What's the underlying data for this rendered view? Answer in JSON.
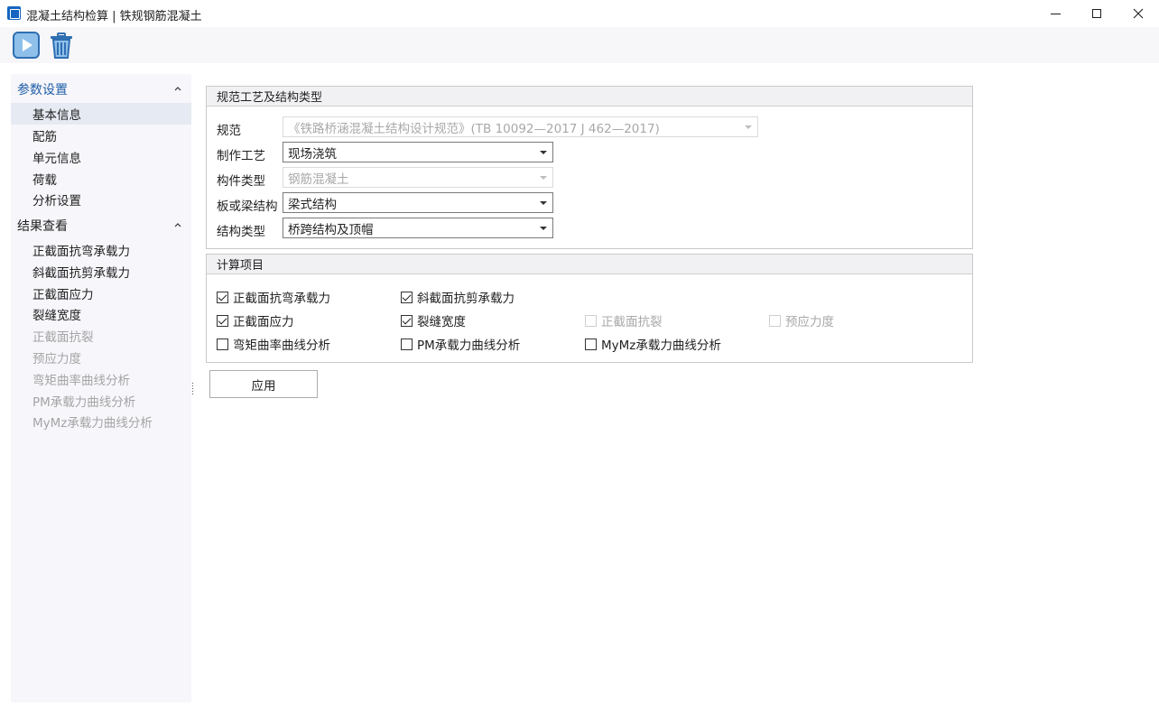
{
  "window": {
    "title": "混凝土结构检算 | 铁规钢筋混凝土"
  },
  "toolbar": {
    "run_icon": "play-icon",
    "delete_icon": "trash-icon"
  },
  "sidebar": {
    "groups": [
      {
        "title": "参数设置",
        "items": [
          {
            "label": "基本信息"
          },
          {
            "label": "配筋"
          },
          {
            "label": "单元信息"
          },
          {
            "label": "荷载"
          },
          {
            "label": "分析设置"
          }
        ]
      },
      {
        "title": "结果查看",
        "items": [
          {
            "label": "正截面抗弯承载力"
          },
          {
            "label": "斜截面抗剪承载力"
          },
          {
            "label": "正截面应力"
          },
          {
            "label": "裂缝宽度"
          },
          {
            "label": "正截面抗裂"
          },
          {
            "label": "预应力度"
          },
          {
            "label": "弯矩曲率曲线分析"
          },
          {
            "label": "PM承载力曲线分析"
          },
          {
            "label": "MyMz承载力曲线分析"
          }
        ]
      }
    ]
  },
  "spec_panel": {
    "title": "规范工艺及结构类型",
    "fields": [
      {
        "label": "规范",
        "value": "《铁路桥涵混凝土结构设计规范》(TB 10092—2017 J 462—2017)"
      },
      {
        "label": "制作工艺",
        "value": "现场浇筑"
      },
      {
        "label": "构件类型",
        "value": "钢筋混凝土"
      },
      {
        "label": "板或梁结构",
        "value": "梁式结构"
      },
      {
        "label": "结构类型",
        "value": "桥跨结构及顶帽"
      }
    ]
  },
  "calc_panel": {
    "title": "计算项目",
    "items": [
      {
        "label": "正截面抗弯承载力",
        "checked": true
      },
      {
        "label": "斜截面抗剪承载力",
        "checked": true
      },
      {
        "label": "正截面应力",
        "checked": true
      },
      {
        "label": "裂缝宽度",
        "checked": true
      },
      {
        "label": "正截面抗裂",
        "checked": false
      },
      {
        "label": "预应力度",
        "checked": false
      },
      {
        "label": "弯矩曲率曲线分析",
        "checked": false
      },
      {
        "label": "PM承载力曲线分析",
        "checked": false
      },
      {
        "label": "MyMz承载力曲线分析",
        "checked": false
      }
    ]
  },
  "apply_button": {
    "label": "应用"
  },
  "colors": {
    "accent": "#1f5fa8",
    "selected_bg": "#e6eaf2",
    "sidebar_bg": "#f7f6fa",
    "disabled_text": "#a4a4a4"
  }
}
